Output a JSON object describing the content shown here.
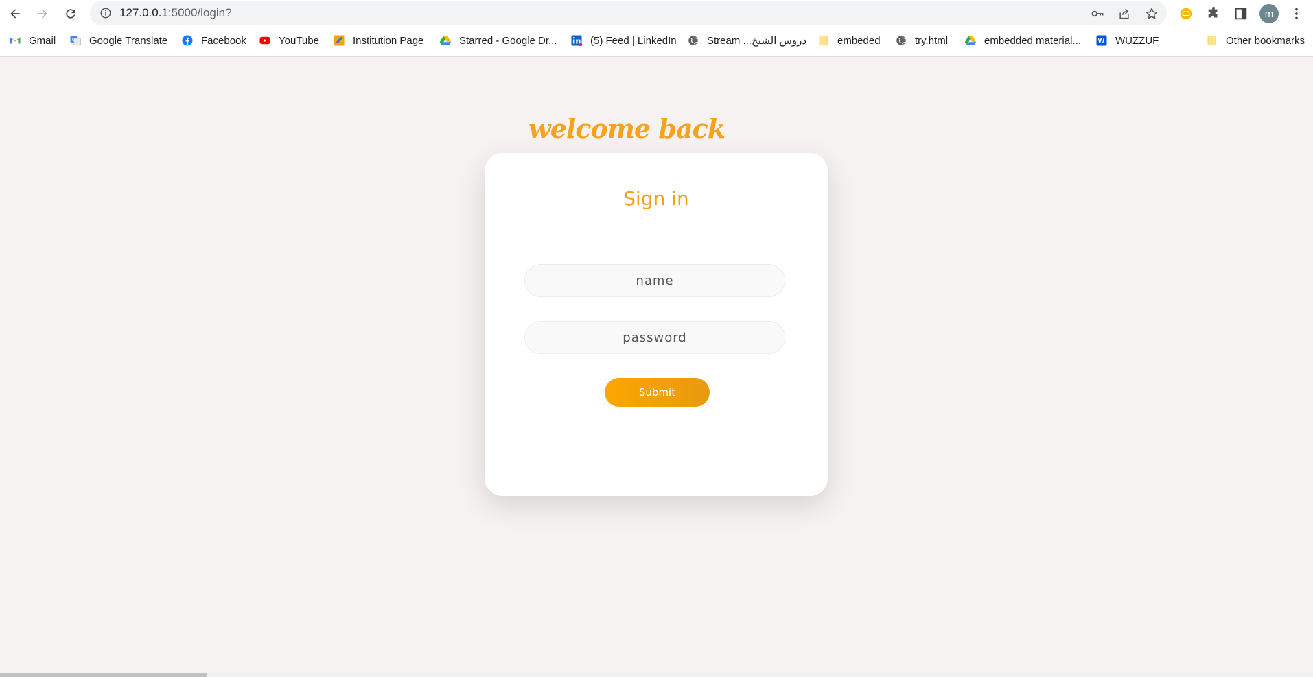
{
  "browser": {
    "url_host": "127.0.0.1",
    "url_path": ":5000/login?",
    "avatar_letter": "m",
    "bookmarks": [
      {
        "label": "Gmail",
        "icon": "gmail-icon"
      },
      {
        "label": "Google Translate",
        "icon": "translate-icon"
      },
      {
        "label": "Facebook",
        "icon": "facebook-icon"
      },
      {
        "label": "YouTube",
        "icon": "youtube-icon"
      },
      {
        "label": "Institution Page",
        "icon": "pencil-icon"
      },
      {
        "label": "Starred - Google Dr...",
        "icon": "google-drive-icon"
      },
      {
        "label": "(5) Feed | LinkedIn",
        "icon": "linkedin-icon"
      },
      {
        "label": "Stream ...دروس الشيخ",
        "icon": "globe-icon"
      },
      {
        "label": "embeded",
        "icon": "folder-icon"
      },
      {
        "label": "try.html",
        "icon": "globe-icon"
      },
      {
        "label": "embedded material...",
        "icon": "google-drive-icon"
      },
      {
        "label": "WUZZUF",
        "icon": "wuzzuf-icon"
      }
    ],
    "other_bookmarks": "Other bookmarks"
  },
  "page": {
    "welcome_text": "welcome back",
    "form_title": "Sign in",
    "name_placeholder": "name",
    "password_placeholder": "password",
    "submit_label": "Submit"
  },
  "colors": {
    "accent": "#f7a21c",
    "page_background": "#f6f2f1",
    "card_background": "#ffffff"
  }
}
